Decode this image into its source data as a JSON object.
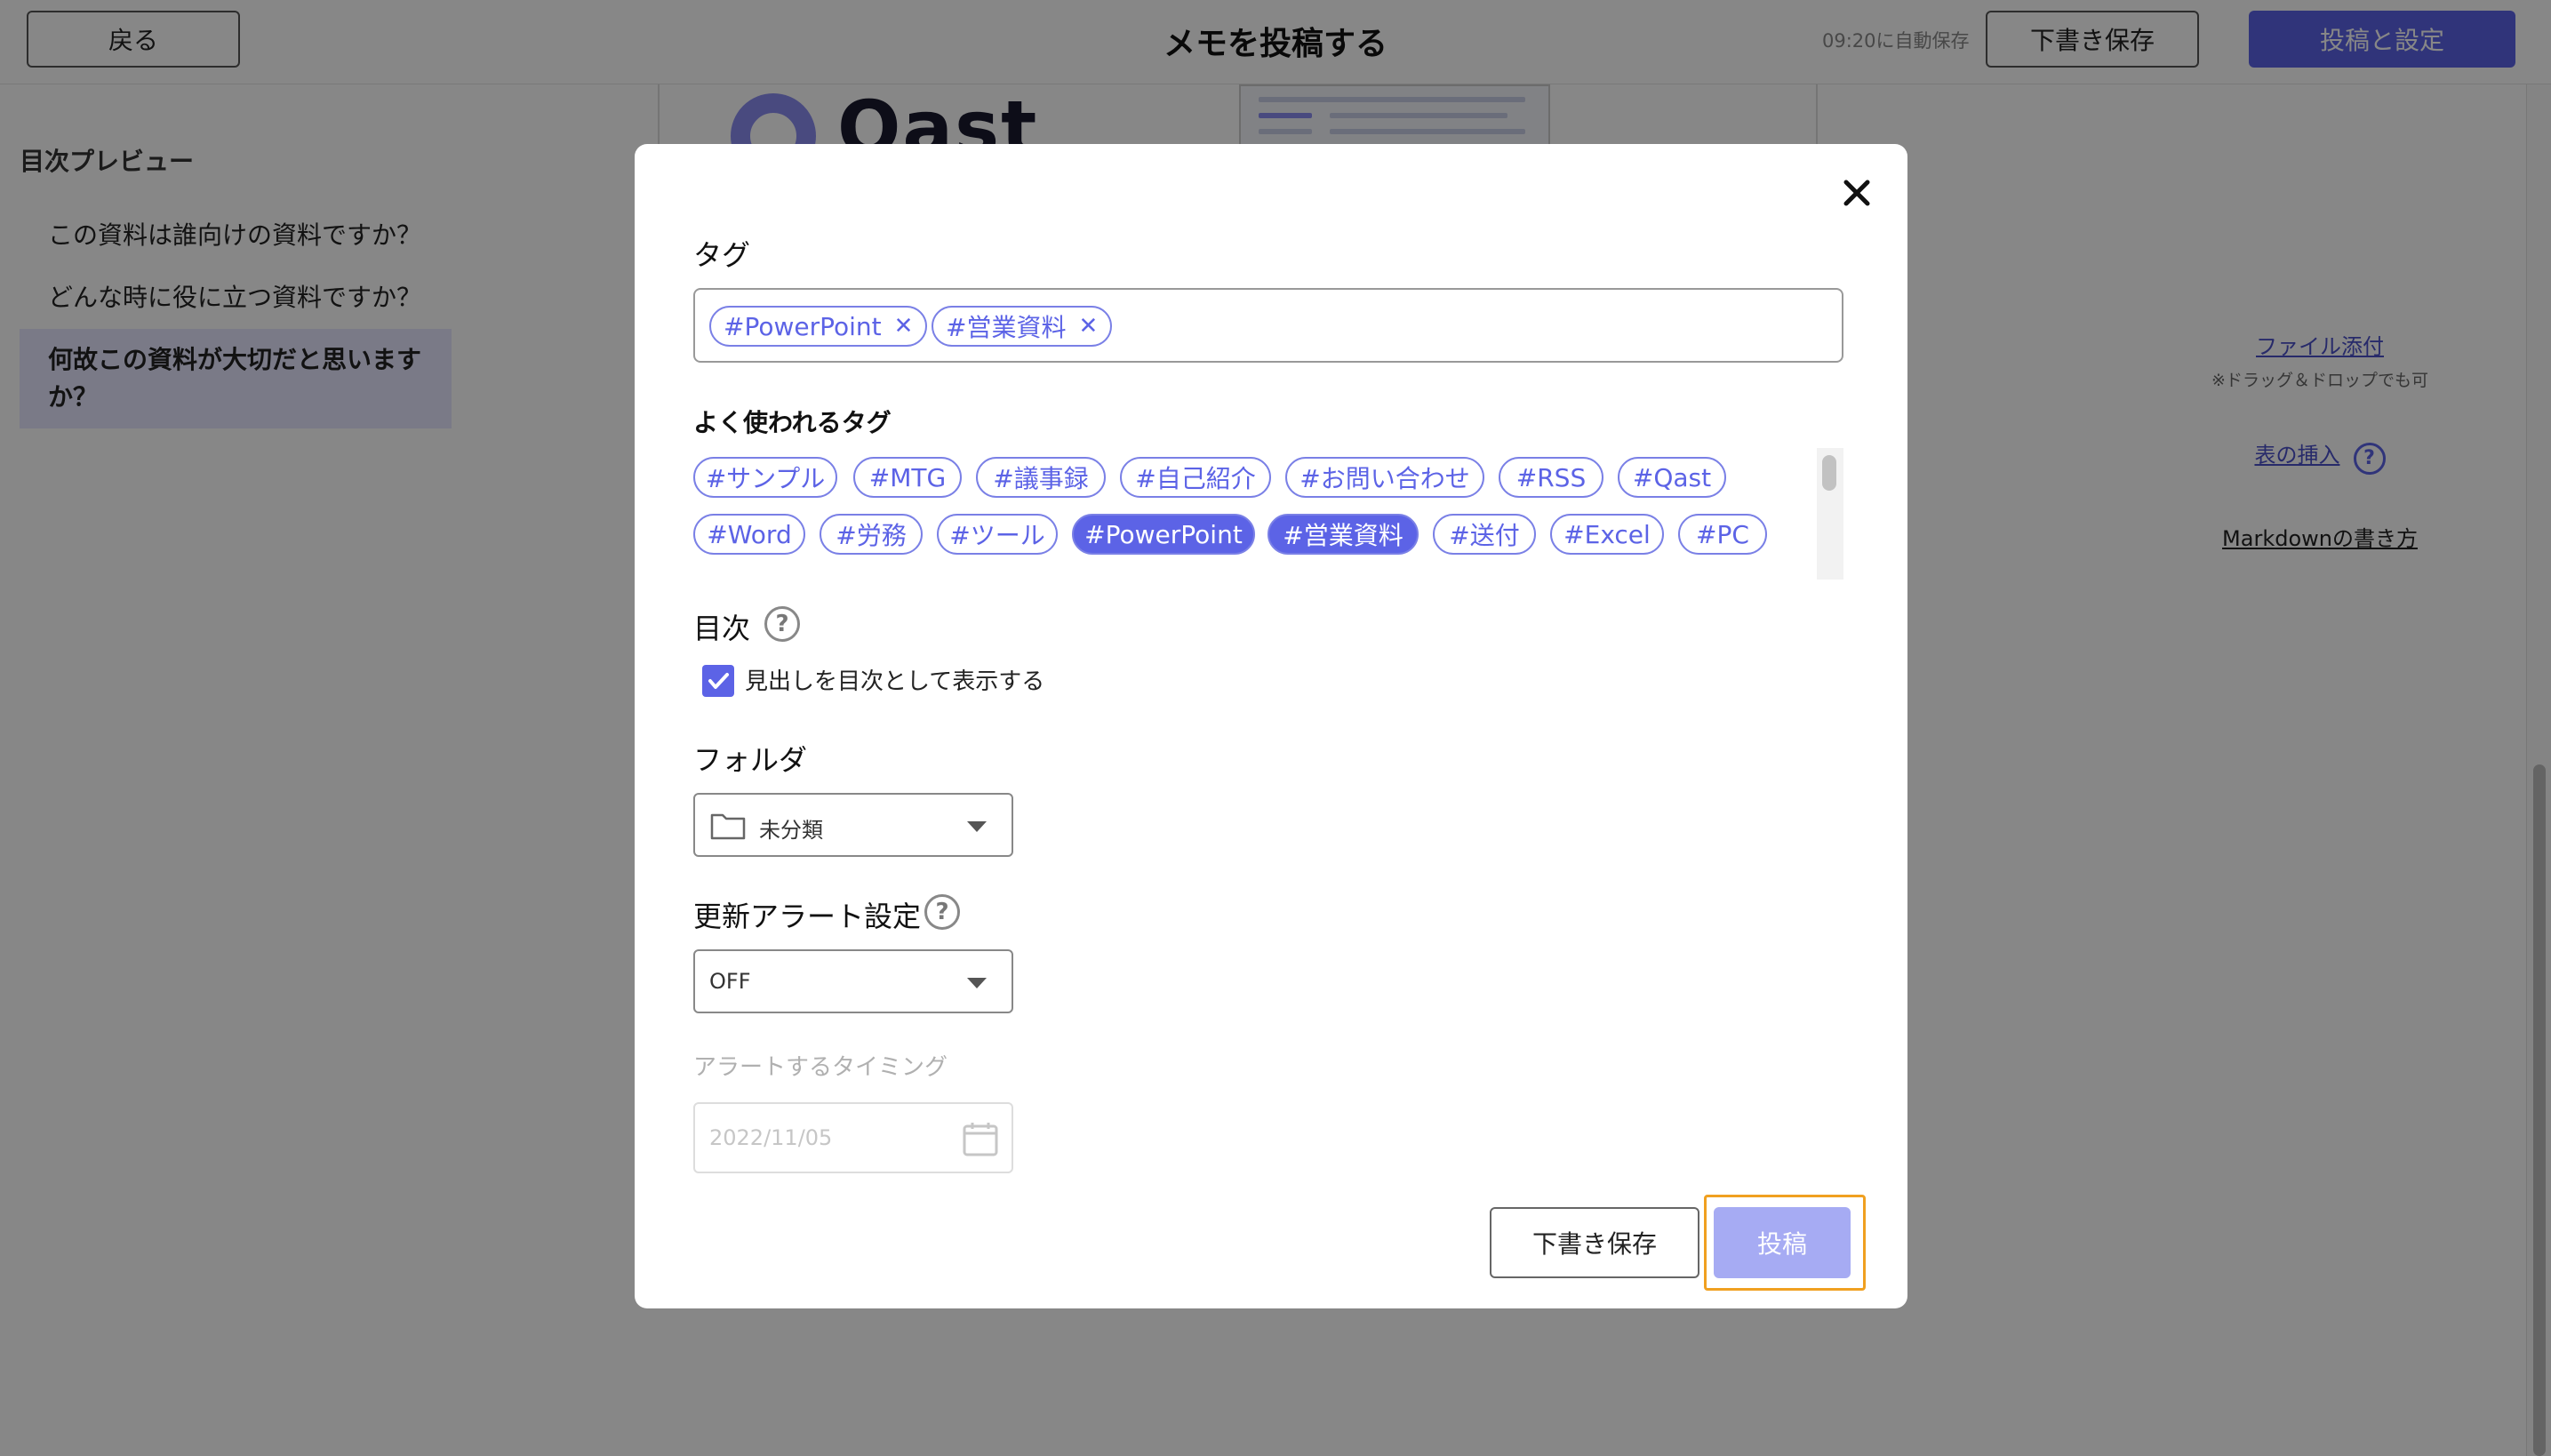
{
  "header": {
    "back_label": "戻る",
    "title": "メモを投稿する",
    "autosave": "09:20に自動保存",
    "draft_label": "下書き保存",
    "post_settings_label": "投稿と設定"
  },
  "toc": {
    "title": "目次プレビュー",
    "items": [
      {
        "label": "この資料は誰向けの資料ですか？"
      },
      {
        "label": "どんな時に役に立つ資料ですか？"
      },
      {
        "label": "何故この資料が大切だと思いますか？"
      }
    ]
  },
  "editor": {
    "logo_text": "Qast"
  },
  "right_panel": {
    "attach": "ファイル添付",
    "attach_hint": "※ドラッグ＆ドロップでも可",
    "table_insert": "表の挿入",
    "markdown": "Markdownの書き方"
  },
  "modal": {
    "tags_title": "タグ",
    "selected_tags": [
      "#PowerPoint",
      "#営業資料"
    ],
    "frequent_title": "よく使われるタグ",
    "frequent_tags": [
      "#サンプル",
      "#MTG",
      "#議事録",
      "#自己紹介",
      "#お問い合わせ",
      "#RSS",
      "#Qast",
      "#Word",
      "#労務",
      "#ツール",
      "#PowerPoint",
      "#営業資料",
      "#送付",
      "#Excel",
      "#PC"
    ],
    "selected_frequent": [
      "#PowerPoint",
      "#営業資料"
    ],
    "toc_title": "目次",
    "toc_checkbox_label": "見出しを目次として表示する",
    "toc_checked": true,
    "folder_title": "フォルダ",
    "folder_value": "未分類",
    "alert_title": "更新アラート設定",
    "alert_value": "OFF",
    "timing_label": "アラートするタイミング",
    "timing_placeholder": "2022/11/05",
    "draft_button": "下書き保存",
    "post_button": "投稿"
  },
  "colors": {
    "accent": "#5c63e6",
    "accent_light": "#a6abf3",
    "focus_ring": "#f0a020",
    "overlay": "rgba(0,0,0,0.47)"
  },
  "icons": [
    "close-icon",
    "help-icon",
    "check-icon",
    "folder-icon",
    "chevron-down-icon",
    "calendar-icon"
  ]
}
